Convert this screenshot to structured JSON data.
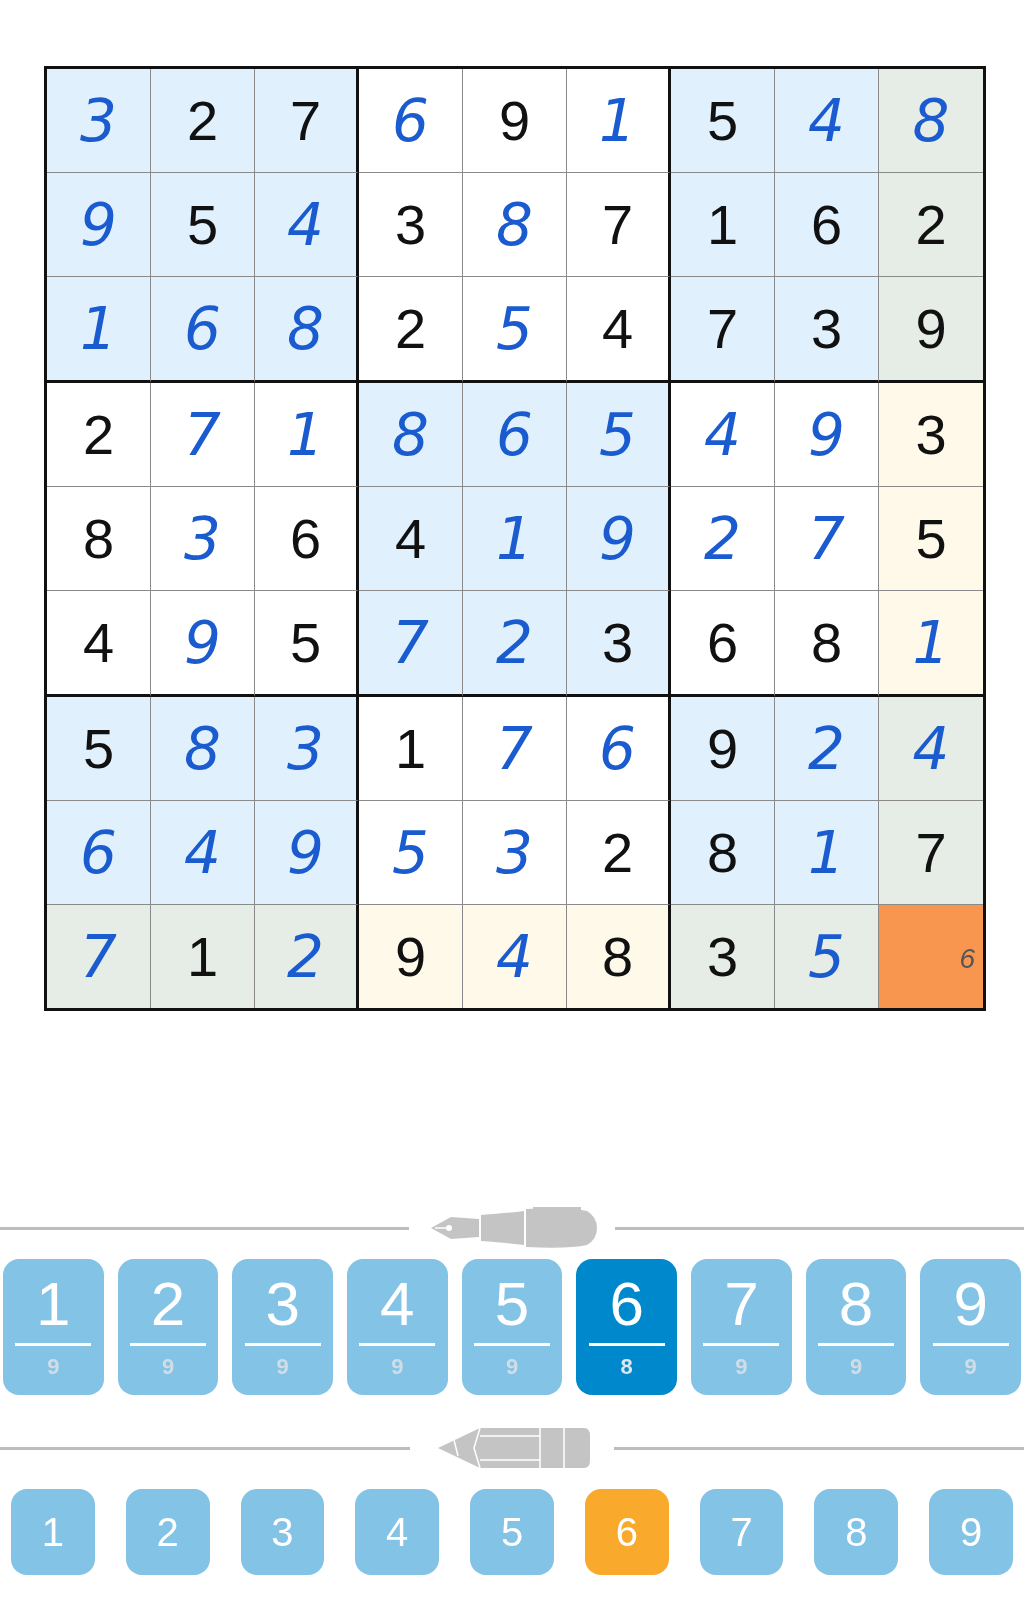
{
  "grid": {
    "rows": [
      [
        {
          "value": "3",
          "kind": "entered",
          "selected": false,
          "highlighted": false
        },
        {
          "value": "2",
          "kind": "given",
          "selected": false,
          "highlighted": false
        },
        {
          "value": "7",
          "kind": "given",
          "selected": false,
          "highlighted": false
        },
        {
          "value": "6",
          "kind": "entered",
          "selected": false,
          "highlighted": false
        },
        {
          "value": "9",
          "kind": "given",
          "selected": false,
          "highlighted": false
        },
        {
          "value": "1",
          "kind": "entered",
          "selected": false,
          "highlighted": false
        },
        {
          "value": "5",
          "kind": "given",
          "selected": false,
          "highlighted": false
        },
        {
          "value": "4",
          "kind": "entered",
          "selected": false,
          "highlighted": false
        },
        {
          "value": "8",
          "kind": "entered",
          "selected": false,
          "highlighted": true
        }
      ],
      [
        {
          "value": "9",
          "kind": "entered",
          "selected": false,
          "highlighted": false
        },
        {
          "value": "5",
          "kind": "given",
          "selected": false,
          "highlighted": false
        },
        {
          "value": "4",
          "kind": "entered",
          "selected": false,
          "highlighted": false
        },
        {
          "value": "3",
          "kind": "given",
          "selected": false,
          "highlighted": false
        },
        {
          "value": "8",
          "kind": "entered",
          "selected": false,
          "highlighted": false
        },
        {
          "value": "7",
          "kind": "given",
          "selected": false,
          "highlighted": false
        },
        {
          "value": "1",
          "kind": "given",
          "selected": false,
          "highlighted": false
        },
        {
          "value": "6",
          "kind": "given",
          "selected": false,
          "highlighted": false
        },
        {
          "value": "2",
          "kind": "given",
          "selected": false,
          "highlighted": true
        }
      ],
      [
        {
          "value": "1",
          "kind": "entered",
          "selected": false,
          "highlighted": false
        },
        {
          "value": "6",
          "kind": "entered",
          "selected": false,
          "highlighted": false
        },
        {
          "value": "8",
          "kind": "entered",
          "selected": false,
          "highlighted": false
        },
        {
          "value": "2",
          "kind": "given",
          "selected": false,
          "highlighted": false
        },
        {
          "value": "5",
          "kind": "entered",
          "selected": false,
          "highlighted": false
        },
        {
          "value": "4",
          "kind": "given",
          "selected": false,
          "highlighted": false
        },
        {
          "value": "7",
          "kind": "given",
          "selected": false,
          "highlighted": false
        },
        {
          "value": "3",
          "kind": "given",
          "selected": false,
          "highlighted": false
        },
        {
          "value": "9",
          "kind": "given",
          "selected": false,
          "highlighted": true
        }
      ],
      [
        {
          "value": "2",
          "kind": "given",
          "selected": false,
          "highlighted": false
        },
        {
          "value": "7",
          "kind": "entered",
          "selected": false,
          "highlighted": false
        },
        {
          "value": "1",
          "kind": "entered",
          "selected": false,
          "highlighted": false
        },
        {
          "value": "8",
          "kind": "entered",
          "selected": false,
          "highlighted": false
        },
        {
          "value": "6",
          "kind": "entered",
          "selected": false,
          "highlighted": false
        },
        {
          "value": "5",
          "kind": "entered",
          "selected": false,
          "highlighted": false
        },
        {
          "value": "4",
          "kind": "entered",
          "selected": false,
          "highlighted": false
        },
        {
          "value": "9",
          "kind": "entered",
          "selected": false,
          "highlighted": false
        },
        {
          "value": "3",
          "kind": "given",
          "selected": false,
          "highlighted": true
        }
      ],
      [
        {
          "value": "8",
          "kind": "given",
          "selected": false,
          "highlighted": false
        },
        {
          "value": "3",
          "kind": "entered",
          "selected": false,
          "highlighted": false
        },
        {
          "value": "6",
          "kind": "given",
          "selected": false,
          "highlighted": false
        },
        {
          "value": "4",
          "kind": "given",
          "selected": false,
          "highlighted": false
        },
        {
          "value": "1",
          "kind": "entered",
          "selected": false,
          "highlighted": false
        },
        {
          "value": "9",
          "kind": "entered",
          "selected": false,
          "highlighted": false
        },
        {
          "value": "2",
          "kind": "entered",
          "selected": false,
          "highlighted": false
        },
        {
          "value": "7",
          "kind": "entered",
          "selected": false,
          "highlighted": false
        },
        {
          "value": "5",
          "kind": "given",
          "selected": false,
          "highlighted": true
        }
      ],
      [
        {
          "value": "4",
          "kind": "given",
          "selected": false,
          "highlighted": false
        },
        {
          "value": "9",
          "kind": "entered",
          "selected": false,
          "highlighted": false
        },
        {
          "value": "5",
          "kind": "given",
          "selected": false,
          "highlighted": false
        },
        {
          "value": "7",
          "kind": "entered",
          "selected": false,
          "highlighted": false
        },
        {
          "value": "2",
          "kind": "entered",
          "selected": false,
          "highlighted": false
        },
        {
          "value": "3",
          "kind": "given",
          "selected": false,
          "highlighted": false
        },
        {
          "value": "6",
          "kind": "given",
          "selected": false,
          "highlighted": false
        },
        {
          "value": "8",
          "kind": "given",
          "selected": false,
          "highlighted": false
        },
        {
          "value": "1",
          "kind": "entered",
          "selected": false,
          "highlighted": true
        }
      ],
      [
        {
          "value": "5",
          "kind": "given",
          "selected": false,
          "highlighted": false
        },
        {
          "value": "8",
          "kind": "entered",
          "selected": false,
          "highlighted": false
        },
        {
          "value": "3",
          "kind": "entered",
          "selected": false,
          "highlighted": false
        },
        {
          "value": "1",
          "kind": "given",
          "selected": false,
          "highlighted": false
        },
        {
          "value": "7",
          "kind": "entered",
          "selected": false,
          "highlighted": false
        },
        {
          "value": "6",
          "kind": "entered",
          "selected": false,
          "highlighted": false
        },
        {
          "value": "9",
          "kind": "given",
          "selected": false,
          "highlighted": false
        },
        {
          "value": "2",
          "kind": "entered",
          "selected": false,
          "highlighted": false
        },
        {
          "value": "4",
          "kind": "entered",
          "selected": false,
          "highlighted": true
        }
      ],
      [
        {
          "value": "6",
          "kind": "entered",
          "selected": false,
          "highlighted": false
        },
        {
          "value": "4",
          "kind": "entered",
          "selected": false,
          "highlighted": false
        },
        {
          "value": "9",
          "kind": "entered",
          "selected": false,
          "highlighted": false
        },
        {
          "value": "5",
          "kind": "entered",
          "selected": false,
          "highlighted": false
        },
        {
          "value": "3",
          "kind": "entered",
          "selected": false,
          "highlighted": false
        },
        {
          "value": "2",
          "kind": "given",
          "selected": false,
          "highlighted": false
        },
        {
          "value": "8",
          "kind": "given",
          "selected": false,
          "highlighted": false
        },
        {
          "value": "1",
          "kind": "entered",
          "selected": false,
          "highlighted": false
        },
        {
          "value": "7",
          "kind": "given",
          "selected": false,
          "highlighted": true
        }
      ],
      [
        {
          "value": "7",
          "kind": "entered",
          "selected": false,
          "highlighted": true
        },
        {
          "value": "1",
          "kind": "given",
          "selected": false,
          "highlighted": true
        },
        {
          "value": "2",
          "kind": "entered",
          "selected": false,
          "highlighted": true
        },
        {
          "value": "9",
          "kind": "given",
          "selected": false,
          "highlighted": true
        },
        {
          "value": "4",
          "kind": "entered",
          "selected": false,
          "highlighted": true
        },
        {
          "value": "8",
          "kind": "given",
          "selected": false,
          "highlighted": true
        },
        {
          "value": "3",
          "kind": "given",
          "selected": false,
          "highlighted": true
        },
        {
          "value": "5",
          "kind": "entered",
          "selected": false,
          "highlighted": true
        },
        {
          "value": "6",
          "kind": "note",
          "selected": true
        }
      ]
    ]
  },
  "pen_pad": {
    "buttons": [
      {
        "digit": "1",
        "remaining": "9",
        "selected": false
      },
      {
        "digit": "2",
        "remaining": "9",
        "selected": false
      },
      {
        "digit": "3",
        "remaining": "9",
        "selected": false
      },
      {
        "digit": "4",
        "remaining": "9",
        "selected": false
      },
      {
        "digit": "5",
        "remaining": "9",
        "selected": false
      },
      {
        "digit": "6",
        "remaining": "8",
        "selected": true
      },
      {
        "digit": "7",
        "remaining": "9",
        "selected": false
      },
      {
        "digit": "8",
        "remaining": "9",
        "selected": false
      },
      {
        "digit": "9",
        "remaining": "9",
        "selected": false
      }
    ]
  },
  "pencil_pad": {
    "buttons": [
      {
        "digit": "1",
        "selected": false
      },
      {
        "digit": "2",
        "selected": false
      },
      {
        "digit": "3",
        "selected": false
      },
      {
        "digit": "4",
        "selected": false
      },
      {
        "digit": "5",
        "selected": false
      },
      {
        "digit": "6",
        "selected": true
      },
      {
        "digit": "7",
        "selected": false
      },
      {
        "digit": "8",
        "selected": false
      },
      {
        "digit": "9",
        "selected": false
      }
    ]
  }
}
